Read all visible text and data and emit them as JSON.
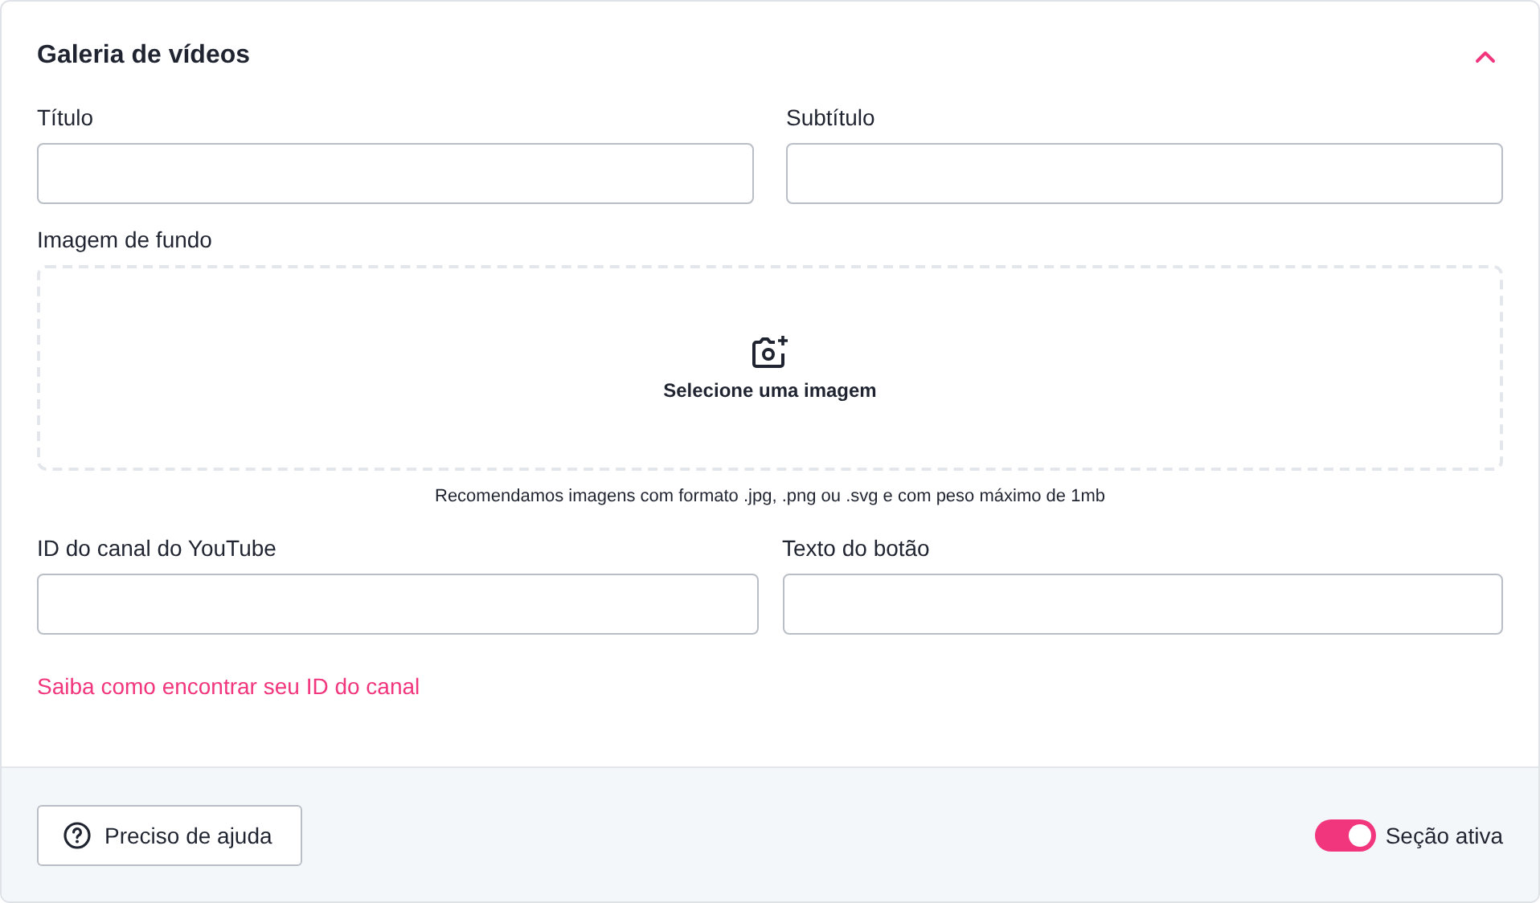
{
  "section": {
    "title": "Galeria de vídeos",
    "expanded": true
  },
  "rows": [
    {
      "fields": [
        {
          "label": "Título"
        },
        {
          "label": "Subtítulo"
        }
      ]
    }
  ],
  "upload": {
    "label": "Imagem de fundo",
    "prompt": "Selecione uma imagem",
    "hint": "Recomendamos imagens com formato .jpg, .png ou .svg e com peso máximo de 1mb"
  },
  "rows2": [
    {
      "fields": [
        {
          "label": "ID do canal do YouTube"
        },
        {
          "label": "Texto do botão"
        }
      ]
    }
  ],
  "link": "Saiba como encontrar seu ID do canal",
  "footer": {
    "help_button": "Preciso de ajuda",
    "toggle": {
      "label": "Seção ativa",
      "on": true
    }
  }
}
